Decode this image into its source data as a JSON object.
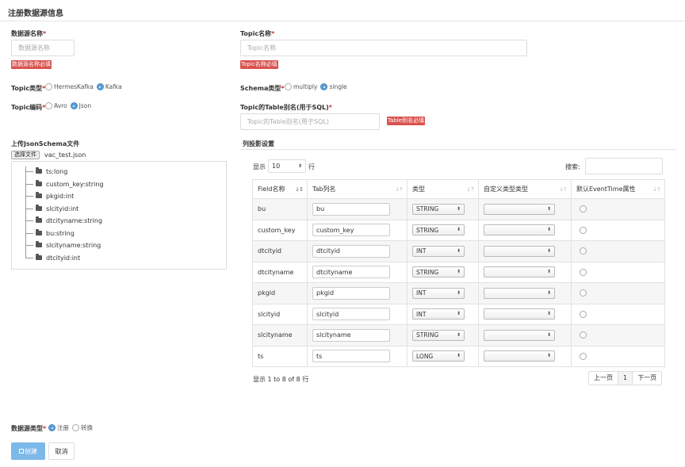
{
  "page_title": "注册数据源信息",
  "required_mark": "*",
  "fields": {
    "ds_name": {
      "label": "数据源名称",
      "placeholder": "数据源名称",
      "error": "数据源名称必填"
    },
    "topic_name": {
      "label": "Topic名称",
      "placeholder": "Topic名称",
      "error": "Topic名称必填"
    },
    "topic_type": {
      "label": "Topic类型",
      "options": [
        "HermesKafka",
        "Kafka"
      ],
      "selected": "Kafka"
    },
    "schema_type": {
      "label": "Schema类型",
      "options": [
        "multiply",
        "single"
      ],
      "selected": "single"
    },
    "topic_encoding": {
      "label": "Topic编码",
      "options": [
        "Avro",
        "Json"
      ],
      "selected": "Json"
    },
    "table_alias": {
      "label": "Topic的Table别名(用于SQL)",
      "placeholder": "Topic的Table别名(用于SQL)",
      "error": "Table别名必填"
    },
    "ds_type": {
      "label": "数据源类型",
      "options": [
        "注册",
        "转换"
      ],
      "selected": "注册"
    }
  },
  "upload": {
    "label": "上传JsonSchema文件",
    "button": "选择文件",
    "file_name": "vac_test.json",
    "tree": [
      "ts:long",
      "custom_key:string",
      "pkgid:int",
      "slcityid:int",
      "dtcityname:string",
      "bu:string",
      "slcityname:string",
      "dtcityid:int"
    ]
  },
  "projection": {
    "title": "列投影设置",
    "length_prefix": "显示",
    "length_value": "10",
    "length_suffix": "行",
    "search_label": "搜索:",
    "columns": [
      "Field名称",
      "Tab列名",
      "类型",
      "自定义类型类型",
      "默认EventTime属性"
    ],
    "rows": [
      {
        "field": "bu",
        "tab": "bu",
        "type": "STRING"
      },
      {
        "field": "custom_key",
        "tab": "custom_key",
        "type": "STRING"
      },
      {
        "field": "dtcityid",
        "tab": "dtcityid",
        "type": "INT"
      },
      {
        "field": "dtcityname",
        "tab": "dtcityname",
        "type": "STRING"
      },
      {
        "field": "pkgid",
        "tab": "pkgid",
        "type": "INT"
      },
      {
        "field": "slcityid",
        "tab": "slcityid",
        "type": "INT"
      },
      {
        "field": "slcityname",
        "tab": "slcityname",
        "type": "STRING"
      },
      {
        "field": "ts",
        "tab": "ts",
        "type": "LONG"
      }
    ],
    "info": "显示 1 to 8 of 8 行",
    "pager": {
      "prev": "上一页",
      "page": "1",
      "next": "下一页"
    }
  },
  "buttons": {
    "create": "创建",
    "cancel": "取消"
  },
  "colors": {
    "primary": "#7cb8e8",
    "error": "#d9534f",
    "radio_selected": "#5b9bd5"
  }
}
